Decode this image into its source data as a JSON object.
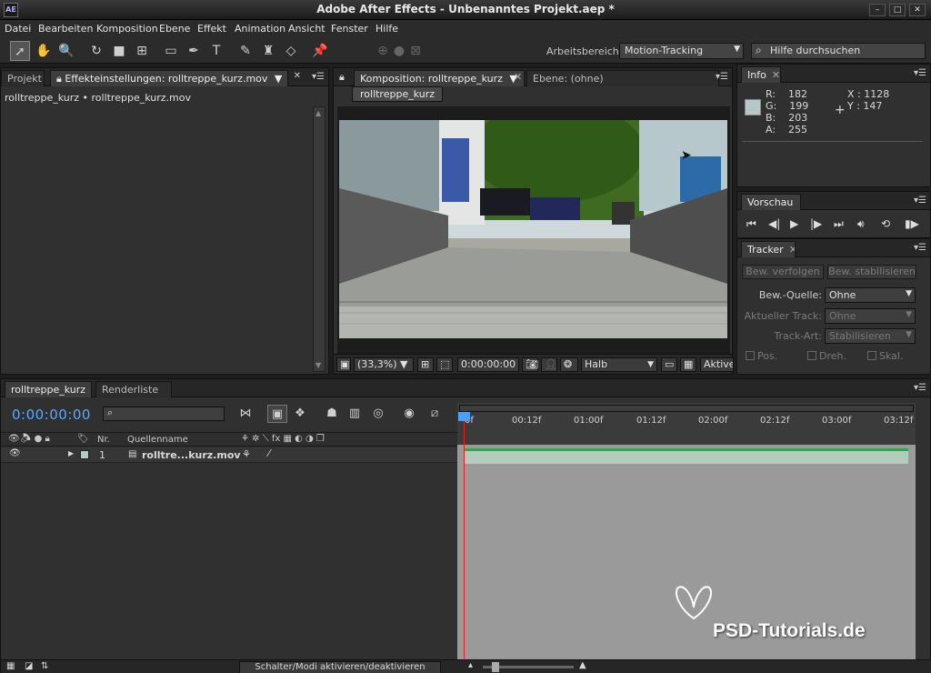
{
  "titlebar": {
    "app_icon": "AE",
    "title": "Adobe After Effects - Unbenanntes Projekt.aep *",
    "minimize": "–",
    "maximize": "□",
    "close": "✕"
  },
  "menu": [
    "Datei",
    "Bearbeiten",
    "Komposition",
    "Ebene",
    "Effekt",
    "Animation",
    "Ansicht",
    "Fenster",
    "Hilfe"
  ],
  "toolbar": {
    "workspace_label": "Arbeitsbereich:",
    "workspace_value": "Motion-Tracking",
    "help_placeholder": "Hilfe durchsuchen"
  },
  "left_panel": {
    "tab_project": "Projekt",
    "tab_effects": "Effekteinstellungen: rolltreppe_kurz.mov",
    "breadcrumb": "rolltreppe_kurz • rolltreppe_kurz.mov"
  },
  "comp_panel": {
    "tab_comp": "Komposition: rolltreppe_kurz",
    "tab_layer": "Ebene: (ohne)",
    "chip": "rolltreppe_kurz",
    "zoom": "(33,3%)",
    "timecode": "0:00:00:00",
    "resolution": "Halb",
    "active_camera": "Aktive"
  },
  "info_panel": {
    "tab": "Info",
    "r": "182",
    "g": "199",
    "b": "203",
    "a": "255",
    "x": "1128",
    "y": "147",
    "swatch_color": "#b6c7cb"
  },
  "preview_panel": {
    "tab": "Vorschau"
  },
  "tracker_panel": {
    "tab": "Tracker",
    "btn_track": "Bew. verfolgen",
    "btn_stabilize": "Bew. stabilisieren",
    "source_label": "Bew.-Quelle:",
    "source_value": "Ohne",
    "current_track_label": "Aktueller Track:",
    "current_track_value": "Ohne",
    "track_type_label": "Track-Art:",
    "track_type_value": "Stabilisieren",
    "pos": "Pos.",
    "rot": "Dreh.",
    "scale": "Skal."
  },
  "timeline": {
    "tab_comp": "rolltreppe_kurz",
    "tab_render": "Renderliste",
    "timecode": "0:00:00:00",
    "col_nr": "Nr.",
    "col_source": "Quellenname",
    "layer_number": "1",
    "layer_name": "rolltre...kurz.mov",
    "ruler": [
      "0f",
      "00:12f",
      "01:00f",
      "01:12f",
      "02:00f",
      "02:12f",
      "03:00f",
      "03:12f"
    ],
    "toggle_modes": "Schalter/Modi aktivieren/deaktivieren",
    "cti_color": "#e02020",
    "layer_bar_color": "#b4ccc0",
    "timecode_color": "#5aa8ff"
  },
  "watermark": {
    "text": "PSD-Tutorials.de"
  }
}
